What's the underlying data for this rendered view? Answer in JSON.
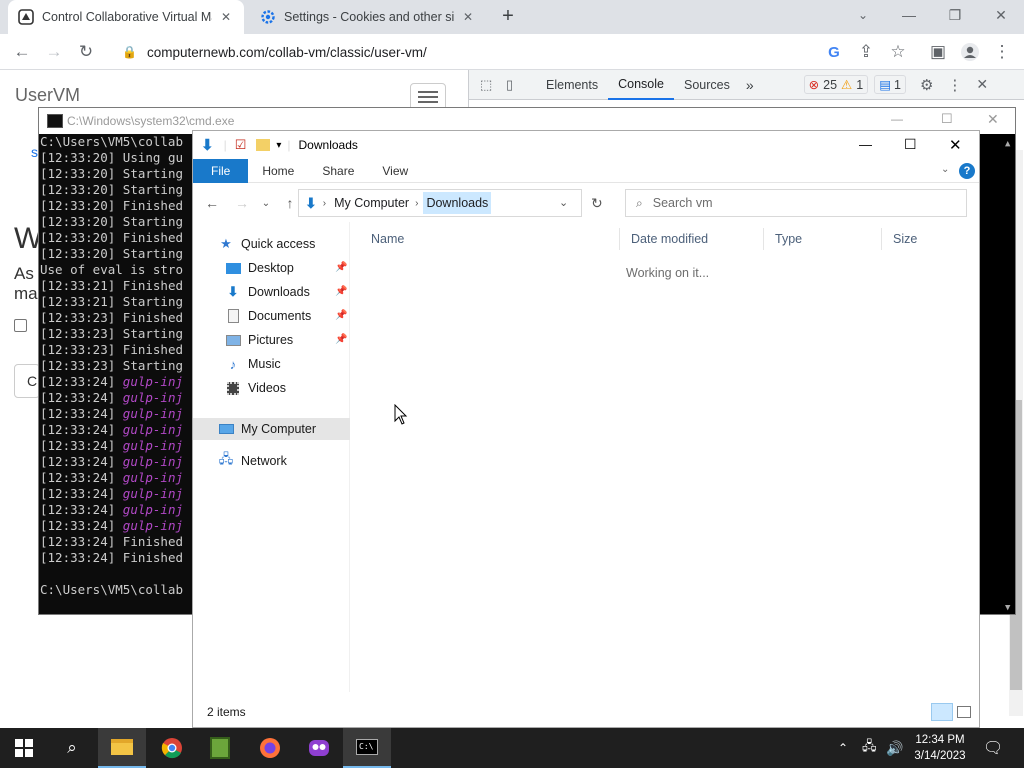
{
  "browser": {
    "tabs": [
      {
        "title": "Control Collaborative Virtual Ma",
        "active": true
      },
      {
        "title": "Settings - Cookies and other site",
        "active": false
      }
    ],
    "new_tab_symbol": "+",
    "url": "computernewb.com/collab-vm/classic/user-vm/"
  },
  "webpage": {
    "heading": "UserVM",
    "fragment_s": "s",
    "fragment_w": "W",
    "fragment_as": "As",
    "fragment_ma": "ma",
    "fragment_c": "C"
  },
  "devtools": {
    "tabs": [
      "Elements",
      "Console",
      "Sources"
    ],
    "active_tab": "Console",
    "more_symbol": "»",
    "error_count": "25",
    "warning_count": "1",
    "message_count": "1"
  },
  "cmd": {
    "title": "C:\\Windows\\system32\\cmd.exe",
    "lines": [
      {
        "ts": "",
        "text": "C:\\Users\\VM5\\collab",
        "color": "#cccccc"
      },
      {
        "ts": "[12:33:20]",
        "text": "Using gu",
        "color": "#cccccc"
      },
      {
        "ts": "[12:33:20]",
        "text": "Starting",
        "color": "#cccccc"
      },
      {
        "ts": "[12:33:20]",
        "text": "Starting",
        "color": "#cccccc"
      },
      {
        "ts": "[12:33:20]",
        "text": "Finished",
        "color": "#cccccc"
      },
      {
        "ts": "[12:33:20]",
        "text": "Starting",
        "color": "#cccccc"
      },
      {
        "ts": "[12:33:20]",
        "text": "Finished",
        "color": "#cccccc"
      },
      {
        "ts": "[12:33:20]",
        "text": "Starting",
        "color": "#cccccc"
      },
      {
        "ts": "",
        "text": "Use of eval is stro",
        "color": "#cccccc"
      },
      {
        "ts": "[12:33:21]",
        "text": "Finished",
        "color": "#cccccc"
      },
      {
        "ts": "[12:33:21]",
        "text": "Starting",
        "color": "#cccccc"
      },
      {
        "ts": "[12:33:23]",
        "text": "Finished",
        "color": "#cccccc"
      },
      {
        "ts": "[12:33:23]",
        "text": "Starting",
        "color": "#cccccc"
      },
      {
        "ts": "[12:33:23]",
        "text": "Finished",
        "color": "#cccccc"
      },
      {
        "ts": "[12:33:23]",
        "text": "Starting",
        "color": "#cccccc"
      },
      {
        "ts": "[12:33:24]",
        "text": "gulp-inj",
        "color": "#b148c6"
      },
      {
        "ts": "[12:33:24]",
        "text": "gulp-inj",
        "color": "#b148c6"
      },
      {
        "ts": "[12:33:24]",
        "text": "gulp-inj",
        "color": "#b148c6"
      },
      {
        "ts": "[12:33:24]",
        "text": "gulp-inj",
        "color": "#b148c6"
      },
      {
        "ts": "[12:33:24]",
        "text": "gulp-inj",
        "color": "#b148c6"
      },
      {
        "ts": "[12:33:24]",
        "text": "gulp-inj",
        "color": "#b148c6"
      },
      {
        "ts": "[12:33:24]",
        "text": "gulp-inj",
        "color": "#b148c6"
      },
      {
        "ts": "[12:33:24]",
        "text": "gulp-inj",
        "color": "#b148c6"
      },
      {
        "ts": "[12:33:24]",
        "text": "gulp-inj",
        "color": "#b148c6"
      },
      {
        "ts": "[12:33:24]",
        "text": "gulp-inj",
        "color": "#b148c6"
      },
      {
        "ts": "[12:33:24]",
        "text": "Finished",
        "color": "#cccccc"
      },
      {
        "ts": "[12:33:24]",
        "text": "Finished",
        "color": "#cccccc"
      },
      {
        "ts": "",
        "text": "",
        "color": "#cccccc"
      },
      {
        "ts": "",
        "text": "C:\\Users\\VM5\\collab",
        "color": "#cccccc"
      }
    ]
  },
  "explorer": {
    "title": "Downloads",
    "ribbon_tabs": [
      "File",
      "Home",
      "Share",
      "View"
    ],
    "breadcrumb": [
      "My Computer",
      "Downloads"
    ],
    "search_placeholder": "Search vm",
    "nav": {
      "quick_access": "Quick access",
      "quick_items": [
        "Desktop",
        "Downloads",
        "Documents",
        "Pictures",
        "Music",
        "Videos"
      ],
      "my_computer": "My Computer",
      "network": "Network"
    },
    "columns": [
      "Name",
      "Date modified",
      "Type",
      "Size"
    ],
    "status_message": "Working on it...",
    "item_count": "2 items"
  },
  "taskbar": {
    "time": "12:34 PM",
    "date": "3/14/2023"
  },
  "colors": {
    "accent": "#1a73e8",
    "file_tab": "#1979ca",
    "console_bg": "#0c0c0c",
    "taskbar_bg": "#1f1f1f",
    "purple": "#b148c6"
  }
}
